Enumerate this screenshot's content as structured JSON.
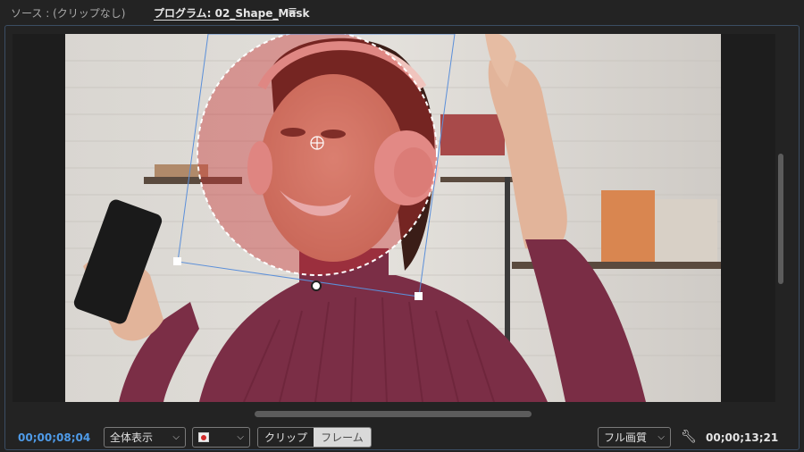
{
  "panel": {
    "source_tab": "ソース : (クリップなし)",
    "program_tab": "プログラム: 02_Shape_Mask",
    "menu_icon": "hamburger-icon"
  },
  "viewer": {
    "mask_shape": "ellipse",
    "mask_color": "#c83232",
    "subject": "woman with pink headphones holding phone"
  },
  "controls": {
    "current_timecode": "00;00;08;04",
    "zoom_select": "全体表示",
    "color_icon": "record-dot-icon",
    "toggle_clip": "クリップ",
    "toggle_frame": "フレーム",
    "quality_select": "フル画質",
    "settings_icon": "wrench-icon",
    "duration_timecode": "00;00;13;21"
  },
  "colors": {
    "accent_timecode": "#4f9be8",
    "panel_border": "#3b4d63",
    "background": "#232323"
  }
}
